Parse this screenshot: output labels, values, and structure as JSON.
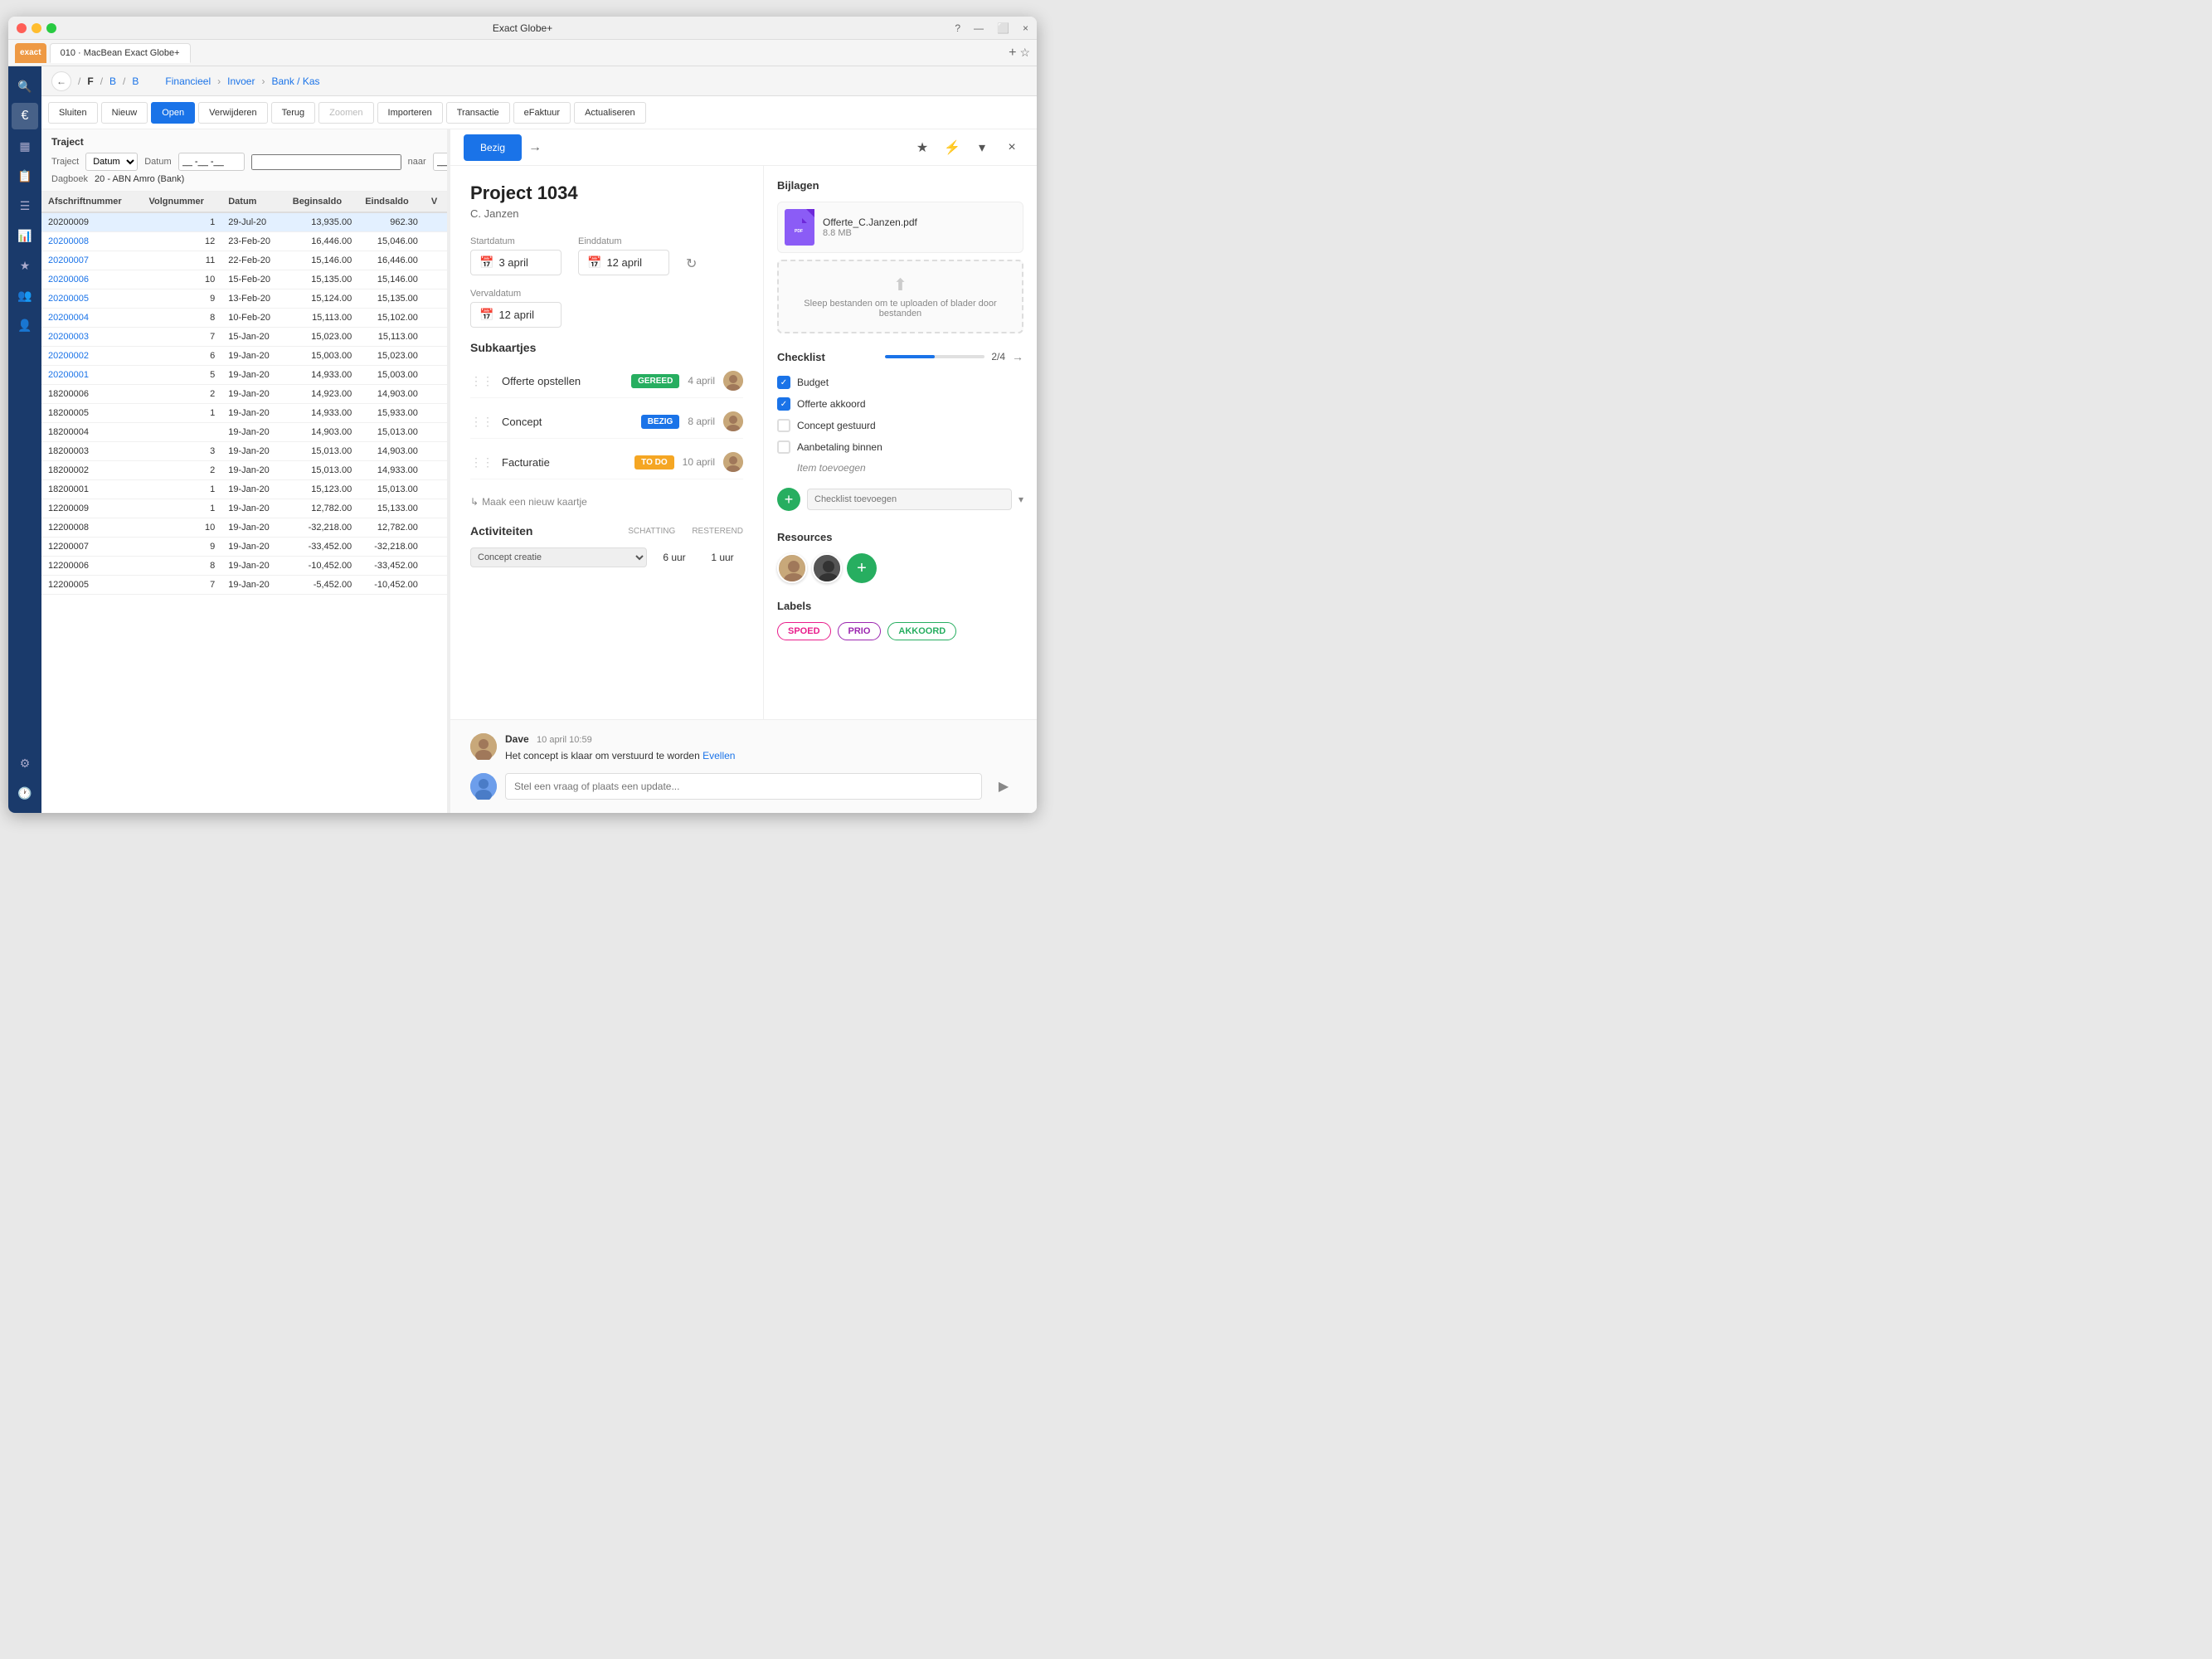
{
  "window": {
    "title": "Exact Globe+"
  },
  "tab": {
    "label": "010 · MacBean Exact Globe+"
  },
  "nav": {
    "back_icon": "←",
    "breadcrumb": [
      "F",
      "B",
      "B"
    ],
    "path": [
      "Financieel",
      "Invoer",
      "Bank / Kas"
    ]
  },
  "toolbar": {
    "sluiten": "Sluiten",
    "nieuw": "Nieuw",
    "open": "Open",
    "verwijderen": "Verwijderen",
    "terug": "Terug",
    "zoomen": "Zoomen",
    "importeren": "Importeren",
    "transactie": "Transactie",
    "efactuur": "eFaktuur",
    "actualiseren": "Actualiseren"
  },
  "traject": {
    "title": "Traject",
    "traject_label": "Traject",
    "datum_label": "Datum",
    "naar_label": "naar",
    "dagboek_label": "Dagboek",
    "dagboek_value": "20 - ABN Amro (Bank)",
    "datum_placeholder": "__ -__ -__",
    "naar_placeholder": "__ -__ -__",
    "datum_select": "Datum"
  },
  "table": {
    "headers": [
      "Afschriftnummer",
      "Volgnummer",
      "Datum",
      "Beginsaldo",
      "Eindsaldo",
      "V"
    ],
    "rows": [
      {
        "afschrift": "20200009",
        "volg": "1",
        "datum": "29-Jul-20",
        "begin": "13,935.00",
        "eind": "962.30",
        "selected": true
      },
      {
        "afschrift": "20200008",
        "volg": "12",
        "datum": "23-Feb-20",
        "begin": "16,446.00",
        "eind": "15,046.00",
        "selected": false
      },
      {
        "afschrift": "20200007",
        "volg": "11",
        "datum": "22-Feb-20",
        "begin": "15,146.00",
        "eind": "16,446.00",
        "selected": false
      },
      {
        "afschrift": "20200006",
        "volg": "10",
        "datum": "15-Feb-20",
        "begin": "15,135.00",
        "eind": "15,146.00",
        "selected": false
      },
      {
        "afschrift": "20200005",
        "volg": "9",
        "datum": "13-Feb-20",
        "begin": "15,124.00",
        "eind": "15,135.00",
        "selected": false
      },
      {
        "afschrift": "20200004",
        "volg": "8",
        "datum": "10-Feb-20",
        "begin": "15,113.00",
        "eind": "15,102.00",
        "selected": false
      },
      {
        "afschrift": "20200003",
        "volg": "7",
        "datum": "15-Jan-20",
        "begin": "15,023.00",
        "eind": "15,113.00",
        "selected": false
      },
      {
        "afschrift": "20200002",
        "volg": "6",
        "datum": "19-Jan-20",
        "begin": "15,003.00",
        "eind": "15,023.00",
        "selected": false
      },
      {
        "afschrift": "20200001",
        "volg": "5",
        "datum": "19-Jan-20",
        "begin": "14,933.00",
        "eind": "15,003.00",
        "selected": false
      },
      {
        "afschrift": "18200006",
        "volg": "2",
        "datum": "19-Jan-20",
        "begin": "14,923.00",
        "eind": "14,903.00",
        "selected": false
      },
      {
        "afschrift": "18200005",
        "volg": "1",
        "datum": "19-Jan-20",
        "begin": "14,933.00",
        "eind": "15,933.00",
        "selected": false
      },
      {
        "afschrift": "18200004",
        "volg": "",
        "datum": "19-Jan-20",
        "begin": "14,903.00",
        "eind": "15,013.00",
        "selected": false
      },
      {
        "afschrift": "18200003",
        "volg": "3",
        "datum": "19-Jan-20",
        "begin": "15,013.00",
        "eind": "14,903.00",
        "selected": false
      },
      {
        "afschrift": "18200002",
        "volg": "2",
        "datum": "19-Jan-20",
        "begin": "15,013.00",
        "eind": "14,933.00",
        "selected": false
      },
      {
        "afschrift": "18200001",
        "volg": "1",
        "datum": "19-Jan-20",
        "begin": "15,123.00",
        "eind": "15,013.00",
        "selected": false
      },
      {
        "afschrift": "12200009",
        "volg": "1",
        "datum": "19-Jan-20",
        "begin": "12,782.00",
        "eind": "15,133.00",
        "selected": false
      },
      {
        "afschrift": "12200008",
        "volg": "10",
        "datum": "19-Jan-20",
        "begin": "-32,218.00",
        "eind": "12,782.00",
        "selected": false
      },
      {
        "afschrift": "12200007",
        "volg": "9",
        "datum": "19-Jan-20",
        "begin": "-33,452.00",
        "eind": "-32,218.00",
        "selected": false
      },
      {
        "afschrift": "12200006",
        "volg": "8",
        "datum": "19-Jan-20",
        "begin": "-10,452.00",
        "eind": "-33,452.00",
        "selected": false
      },
      {
        "afschrift": "12200005",
        "volg": "7",
        "datum": "19-Jan-20",
        "begin": "-5,452.00",
        "eind": "-10,452.00",
        "selected": false
      }
    ]
  },
  "project": {
    "status": "Bezig",
    "title": "Project 1034",
    "client": "C. Janzen",
    "startdatum_label": "Startdatum",
    "startdatum": "3 april",
    "einddatum_label": "Einddatum",
    "einddatum": "12 april",
    "vervaldatum_label": "Vervaldatum",
    "vervaldatum": "12 april",
    "subkaartjes_title": "Subkaartjes",
    "subkaartjes": [
      {
        "name": "Offerte opstellen",
        "status": "GEREED",
        "status_class": "status-gereed",
        "date": "4 april"
      },
      {
        "name": "Concept",
        "status": "BEZIG",
        "status_class": "status-bezig",
        "date": "8 april"
      },
      {
        "name": "Facturatie",
        "status": "TO DO",
        "status_class": "status-todo",
        "date": "10 april"
      }
    ],
    "new_card_label": "Maak een nieuw kaartje",
    "activiteiten_title": "Activiteiten",
    "schatting_label": "SCHATTING",
    "resterend_label": "RESTEREND",
    "activiteit_name": "Concept creatie",
    "activiteit_schatting": "6 uur",
    "activiteit_resterend": "1 uur"
  },
  "bijlagen": {
    "title": "Bijlagen",
    "file_name": "Offerte_C.Janzen.pdf",
    "file_size": "8.8 MB",
    "upload_text": "Sleep bestanden om te uploaden of blader door bestanden"
  },
  "checklist": {
    "title": "Checklist",
    "progress": "2/4",
    "progress_pct": 50,
    "items": [
      {
        "label": "Budget",
        "checked": true
      },
      {
        "label": "Offerte akkoord",
        "checked": true
      },
      {
        "label": "Concept gestuurd",
        "checked": false
      },
      {
        "label": "Aanbetaling binnen",
        "checked": false
      }
    ],
    "add_placeholder": "Item toevoegen",
    "add_checklist_placeholder": "Checklist toevoegen"
  },
  "resources": {
    "title": "Resources"
  },
  "labels": {
    "title": "Labels",
    "items": [
      {
        "label": "SPOED",
        "class": "label-spoed"
      },
      {
        "label": "PRIO",
        "class": "label-prio"
      },
      {
        "label": "AKKOORD",
        "class": "label-akkoord"
      }
    ]
  },
  "comment": {
    "author": "Dave",
    "time": "10 april 10:59",
    "text_before": "Het concept is klaar om verstuurd te worden ",
    "mention": "Evellen",
    "input_placeholder": "Stel een vraag of plaats een update..."
  },
  "icons": {
    "search": "🔍",
    "home": "⌂",
    "document": "📄",
    "chart": "📊",
    "settings": "⚙",
    "users": "👥",
    "profile": "👤",
    "clock": "🕐",
    "star": "★",
    "lightning": "⚡",
    "close": "×",
    "arrow_right": "→",
    "back": "←",
    "calendar": "📅",
    "sync": "↻",
    "drag": "⋮⋮",
    "add": "+",
    "send": "▶",
    "check": "✓"
  }
}
